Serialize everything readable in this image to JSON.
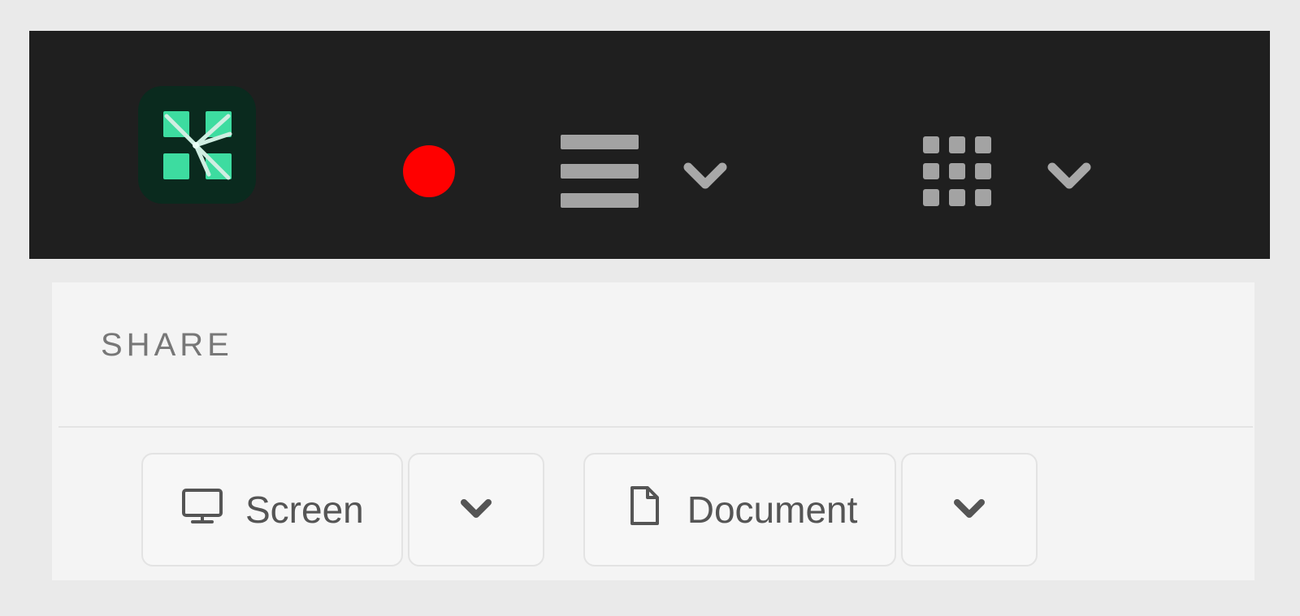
{
  "window": {
    "background_color": "#eaeaea"
  },
  "toolbar": {
    "background_color": "#1f1f1f",
    "logo": {
      "icon": "kaltura-logo-icon",
      "tile_color": "#0a2a1e",
      "mark_color": "#3ddca0"
    },
    "items": [
      {
        "icon": "record-dot-icon",
        "color": "#ff0000"
      },
      {
        "icon": "list-view-icon",
        "color": "#a3a3a3"
      },
      {
        "icon": "chevron-down-icon",
        "color": "#a8a8a8"
      },
      {
        "icon": "grid-view-icon",
        "color": "#a3a3a3"
      },
      {
        "icon": "chevron-down-icon",
        "color": "#a8a8a8"
      }
    ]
  },
  "panel": {
    "background_color": "#f4f4f4",
    "section_title": "SHARE",
    "share_options": [
      {
        "label": "Screen",
        "icon": "monitor-icon",
        "caret_icon": "chevron-down-icon"
      },
      {
        "label": "Document",
        "icon": "document-icon",
        "caret_icon": "chevron-down-icon"
      }
    ]
  }
}
